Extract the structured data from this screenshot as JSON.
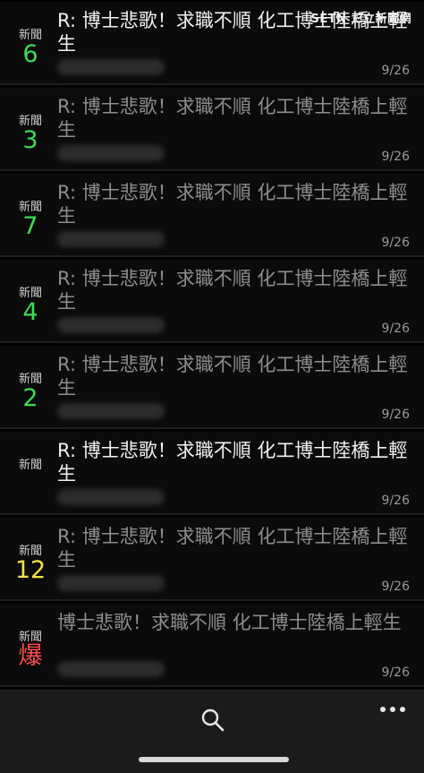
{
  "watermark": "SETN 三立新聞網",
  "posts": [
    {
      "category": "新聞",
      "count": "6",
      "count_color": "#3ddc55",
      "title": "R: 博士悲歌！求職不順 化工博士陸橋上輕生",
      "read": false,
      "date": "9/26"
    },
    {
      "category": "新聞",
      "count": "3",
      "count_color": "#3ddc55",
      "title": "R: 博士悲歌！求職不順 化工博士陸橋上輕生",
      "read": true,
      "date": "9/26"
    },
    {
      "category": "新聞",
      "count": "7",
      "count_color": "#3ddc55",
      "title": "R: 博士悲歌！求職不順 化工博士陸橋上輕生",
      "read": true,
      "date": "9/26"
    },
    {
      "category": "新聞",
      "count": "4",
      "count_color": "#3ddc55",
      "title": "R: 博士悲歌！求職不順 化工博士陸橋上輕生",
      "read": true,
      "date": "9/26"
    },
    {
      "category": "新聞",
      "count": "2",
      "count_color": "#3ddc55",
      "title": "R: 博士悲歌！求職不順 化工博士陸橋上輕生",
      "read": true,
      "date": "9/26"
    },
    {
      "category": "新聞",
      "count": "",
      "count_color": "#3ddc55",
      "title": "R: 博士悲歌！求職不順 化工博士陸橋上輕生",
      "read": false,
      "date": "9/26"
    },
    {
      "category": "新聞",
      "count": "12",
      "count_color": "#f2e24a",
      "title": "R: 博士悲歌！求職不順 化工博士陸橋上輕生",
      "read": true,
      "date": "9/26"
    },
    {
      "category": "新聞",
      "count": "爆",
      "count_color": "#ff4a4a",
      "title": "博士悲歌！求職不順 化工博士陸橋上輕生",
      "read": true,
      "date": "9/26"
    }
  ],
  "toolbar": {
    "search_icon": "search-icon",
    "more_icon": "more-icon"
  }
}
